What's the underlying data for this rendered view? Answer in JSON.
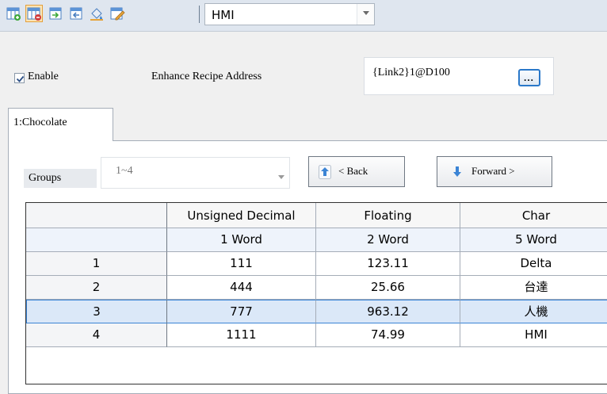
{
  "toolbar": {
    "buttons": [
      {
        "name": "add-table-icon"
      },
      {
        "name": "delete-table-icon"
      },
      {
        "name": "import-icon"
      },
      {
        "name": "export-icon"
      },
      {
        "name": "fill-icon"
      },
      {
        "name": "edit-icon"
      }
    ],
    "combo_value": "HMI"
  },
  "enable": {
    "label": "Enable",
    "checked": true
  },
  "enhance_recipe": {
    "label": "Enhance Recipe Address",
    "value": "{Link2}1@D100",
    "browse_label": "..."
  },
  "tab": {
    "label": "1:Chocolate"
  },
  "groups": {
    "label": "Groups",
    "value": "1~4"
  },
  "nav": {
    "back_label": "< Back",
    "forward_label": "Forward >"
  },
  "grid": {
    "columns": [
      "Unsigned Decimal",
      "Floating",
      "Char"
    ],
    "types": [
      "1 Word",
      "2 Word",
      "5 Word"
    ],
    "rows": [
      {
        "id": "1",
        "cells": [
          "111",
          "123.11",
          "Delta"
        ]
      },
      {
        "id": "2",
        "cells": [
          "444",
          "25.66",
          "台達"
        ]
      },
      {
        "id": "3",
        "cells": [
          "777",
          "963.12",
          "人機"
        ]
      },
      {
        "id": "4",
        "cells": [
          "1111",
          "74.99",
          "HMI"
        ]
      }
    ],
    "selected_row": "3"
  },
  "colors": {
    "accent": "#3b84d5",
    "selection": "#dbe8f8",
    "toolbar_bg": "#dfe6ef"
  }
}
